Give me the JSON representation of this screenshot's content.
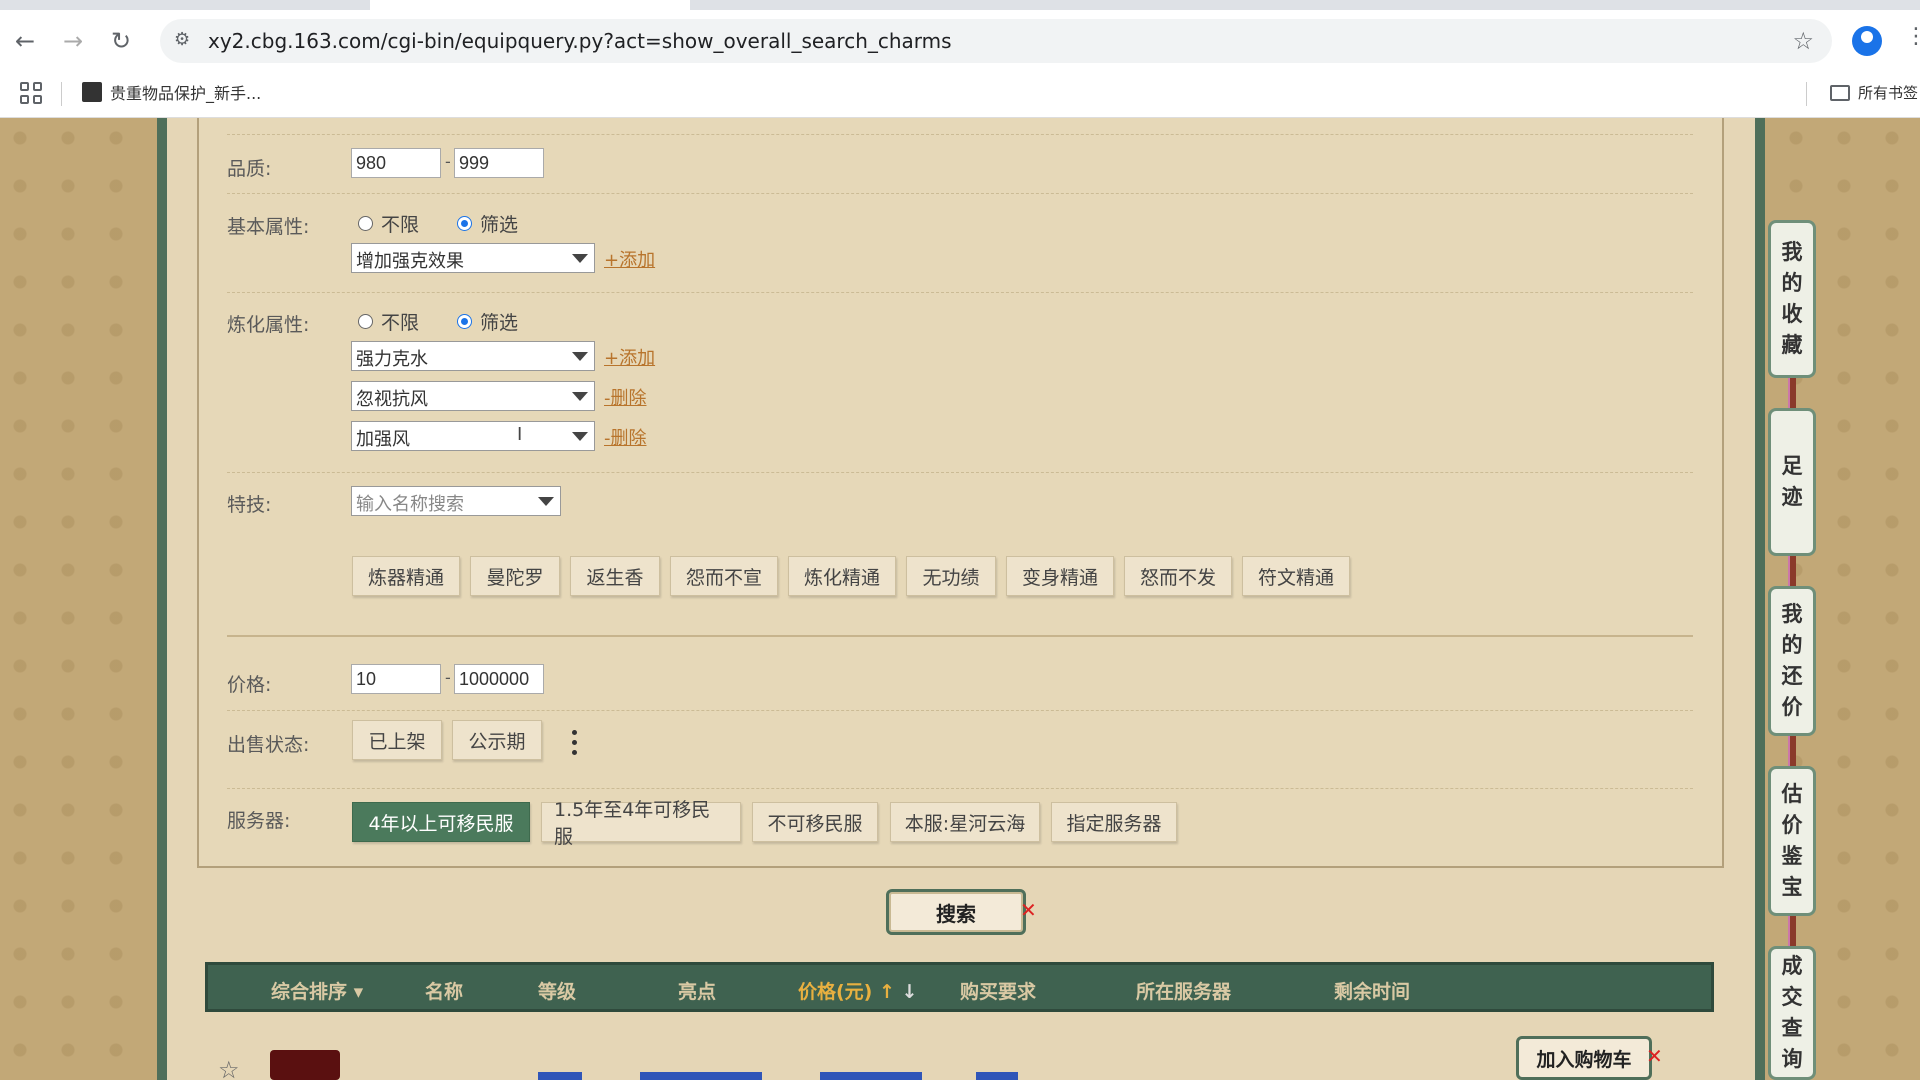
{
  "browser": {
    "url": "xy2.cbg.163.com/cgi-bin/equipquery.py?act=show_overall_search_charms",
    "bookmark_label": "贵重物品保护_新手...",
    "all_bookmarks_label": "所有书签"
  },
  "filters": {
    "quality": {
      "label": "品质:",
      "min": "980",
      "max": "999"
    },
    "basic_attr": {
      "label": "基本属性:",
      "options": [
        "不限",
        "筛选"
      ],
      "selected": "筛选",
      "select_value": "增加强克效果",
      "add_link": "+添加"
    },
    "refine_attr": {
      "label": "炼化属性:",
      "options": [
        "不限",
        "筛选"
      ],
      "selected": "筛选",
      "rows": [
        {
          "value": "强力克水",
          "action": "+添加"
        },
        {
          "value": "忽视抗风",
          "action": "-删除"
        },
        {
          "value": "加强风",
          "action": "-删除"
        }
      ]
    },
    "skill": {
      "label": "特技:",
      "placeholder": "输入名称搜索",
      "tags": [
        "炼器精通",
        "曼陀罗",
        "返生香",
        "怨而不宣",
        "炼化精通",
        "无功绩",
        "变身精通",
        "怒而不发",
        "符文精通"
      ]
    },
    "price": {
      "label": "价格:",
      "min": "10",
      "max": "1000000"
    },
    "sale_status": {
      "label": "出售状态:",
      "options": [
        "已上架",
        "公示期"
      ]
    },
    "server": {
      "label": "服务器:",
      "options": [
        "4年以上可移民服",
        "1.5年至4年可移民服",
        "不可移民服",
        "本服:星河云海",
        "指定服务器"
      ],
      "active": "4年以上可移民服"
    }
  },
  "search_button": "搜索",
  "table": {
    "headers": [
      "综合排序",
      "名称",
      "等级",
      "亮点",
      "价格(元)",
      "购买要求",
      "所在服务器",
      "剩余时间"
    ]
  },
  "cart_button": "加入购物车",
  "side_nav": [
    "我的收藏",
    "足迹",
    "我的还价",
    "估价鉴宝",
    "成交查询"
  ],
  "colors": {
    "accent_green": "#4b7a5c",
    "panel_bg": "#e6d8b8",
    "link": "#b8742c",
    "header_green": "#3f6250"
  }
}
